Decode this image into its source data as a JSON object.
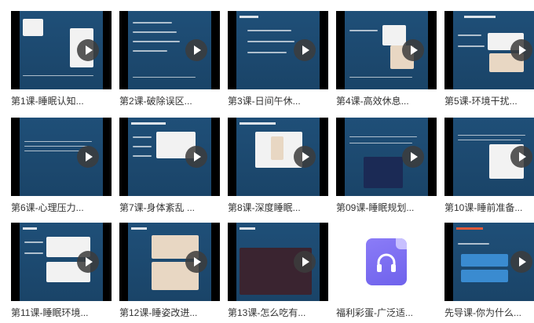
{
  "items": [
    {
      "label": "第1课-睡眠认知...",
      "type": "video"
    },
    {
      "label": "第2课-破除误区...",
      "type": "video"
    },
    {
      "label": "第3课-日间午休...",
      "type": "video"
    },
    {
      "label": "第4课-高效休息...",
      "type": "video"
    },
    {
      "label": "第5课-环境干扰...",
      "type": "video"
    },
    {
      "label": "第6课-心理压力...",
      "type": "video"
    },
    {
      "label": "第7课-身体紊乱 ...",
      "type": "video"
    },
    {
      "label": "第8课-深度睡眠...",
      "type": "video"
    },
    {
      "label": "第09课-睡眠规划...",
      "type": "video"
    },
    {
      "label": "第10课-睡前准备...",
      "type": "video"
    },
    {
      "label": "第11课-睡眠环境...",
      "type": "video"
    },
    {
      "label": "第12课-睡姿改进...",
      "type": "video"
    },
    {
      "label": "第13课-怎么吃有...",
      "type": "video"
    },
    {
      "label": "福利彩蛋-广泛适...",
      "type": "audio"
    },
    {
      "label": "先导课-你为什么...",
      "type": "video"
    }
  ],
  "colors": {
    "slide_bg": "#1f4f78",
    "audio_icon": "#7a6cf2",
    "label_text": "#333333"
  }
}
